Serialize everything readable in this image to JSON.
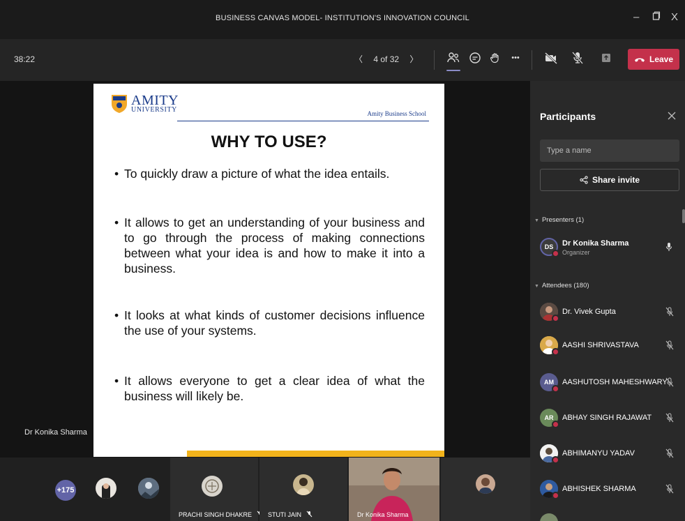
{
  "window": {
    "title": "BUSINESS CANVAS MODEL- INSTITUTION'S INNOVATION COUNCIL",
    "minimize": "–",
    "maximize": "□",
    "close": "X"
  },
  "toolbar": {
    "timer": "38:22",
    "page_indicator": "4 of 32",
    "prev": "〈",
    "next": "〉",
    "more": "•••",
    "leave_label": "Leave",
    "leave_color": "#c4314b",
    "active_indicator_color": "#8b8cc7",
    "icons": [
      "participants-icon",
      "chat-icon",
      "raise-hand-icon",
      "more-icon",
      "camera-off-icon",
      "mic-off-icon",
      "share-tray-icon",
      "phone-hangup-icon"
    ]
  },
  "slide": {
    "logo_big": "AMITY",
    "logo_small": "UNIVERSITY",
    "school": "Amity Business School",
    "title": "WHY TO USE?",
    "bullets": [
      "To quickly draw a picture of what the idea entails.",
      "It allows to get an understanding of your business and to go through the process of making connections between what your idea is and how to make it into a business.",
      "It looks at what kinds of customer decisions influence the use of your systems.",
      "It allows everyone to get a clear idea of what the business will likely be."
    ],
    "accent_bar_color": "#f2b31b"
  },
  "stage": {
    "speaker_name": "Dr Konika Sharma"
  },
  "strip": {
    "overflow_count": "+175",
    "tiles": [
      {
        "label": "PRACHI SINGH DHAKRE"
      },
      {
        "label": "STUTI JAIN"
      },
      {
        "label": "Dr Konika Sharma"
      }
    ]
  },
  "panel": {
    "title": "Participants",
    "search_placeholder": "Type a name",
    "share_invite": "Share invite",
    "presenters_label": "Presenters (1)",
    "attendees_label": "Attendees (180)",
    "presenter": {
      "initials": "DS",
      "name": "Dr Konika Sharma",
      "role": "Organizer"
    },
    "attendees": [
      {
        "name": "Dr. Vivek Gupta",
        "initials": ""
      },
      {
        "name": "AASHI SHRIVASTAVA",
        "initials": ""
      },
      {
        "name": "AASHUTOSH MAHESHWARY",
        "initials": "AM"
      },
      {
        "name": "ABHAY SINGH RAJAWAT",
        "initials": "AR"
      },
      {
        "name": "ABHIMANYU YADAV",
        "initials": ""
      },
      {
        "name": "ABHISHEK SHARMA",
        "initials": ""
      }
    ]
  }
}
